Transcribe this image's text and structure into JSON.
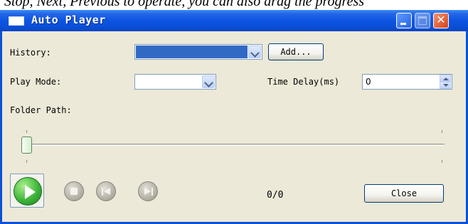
{
  "caption": "Stop, Next, Previous to operate, you can also drag the progress",
  "window": {
    "title": "Auto Player",
    "controls": [
      "minimize-icon",
      "maximize-icon",
      "close-icon"
    ],
    "close_glyph": "✕"
  },
  "history": {
    "label": "History:",
    "value": "",
    "add_label": "Add..."
  },
  "play_mode": {
    "label": "Play Mode:",
    "value": ""
  },
  "time_delay": {
    "label": "Time Delay(ms)",
    "value": "0"
  },
  "folder_path": {
    "label": "Folder Path:"
  },
  "progress": {
    "value": 0,
    "counter": "0/0"
  },
  "buttons": {
    "play": "play-icon",
    "stop": "stop-icon",
    "previous": "previous-icon",
    "next": "next-icon",
    "close_label": "Close"
  },
  "colors": {
    "titlebar": "#0a4fd6",
    "window_bg": "#ece9d8",
    "selection": "#316ac5",
    "play_green": "#3fb53a"
  }
}
